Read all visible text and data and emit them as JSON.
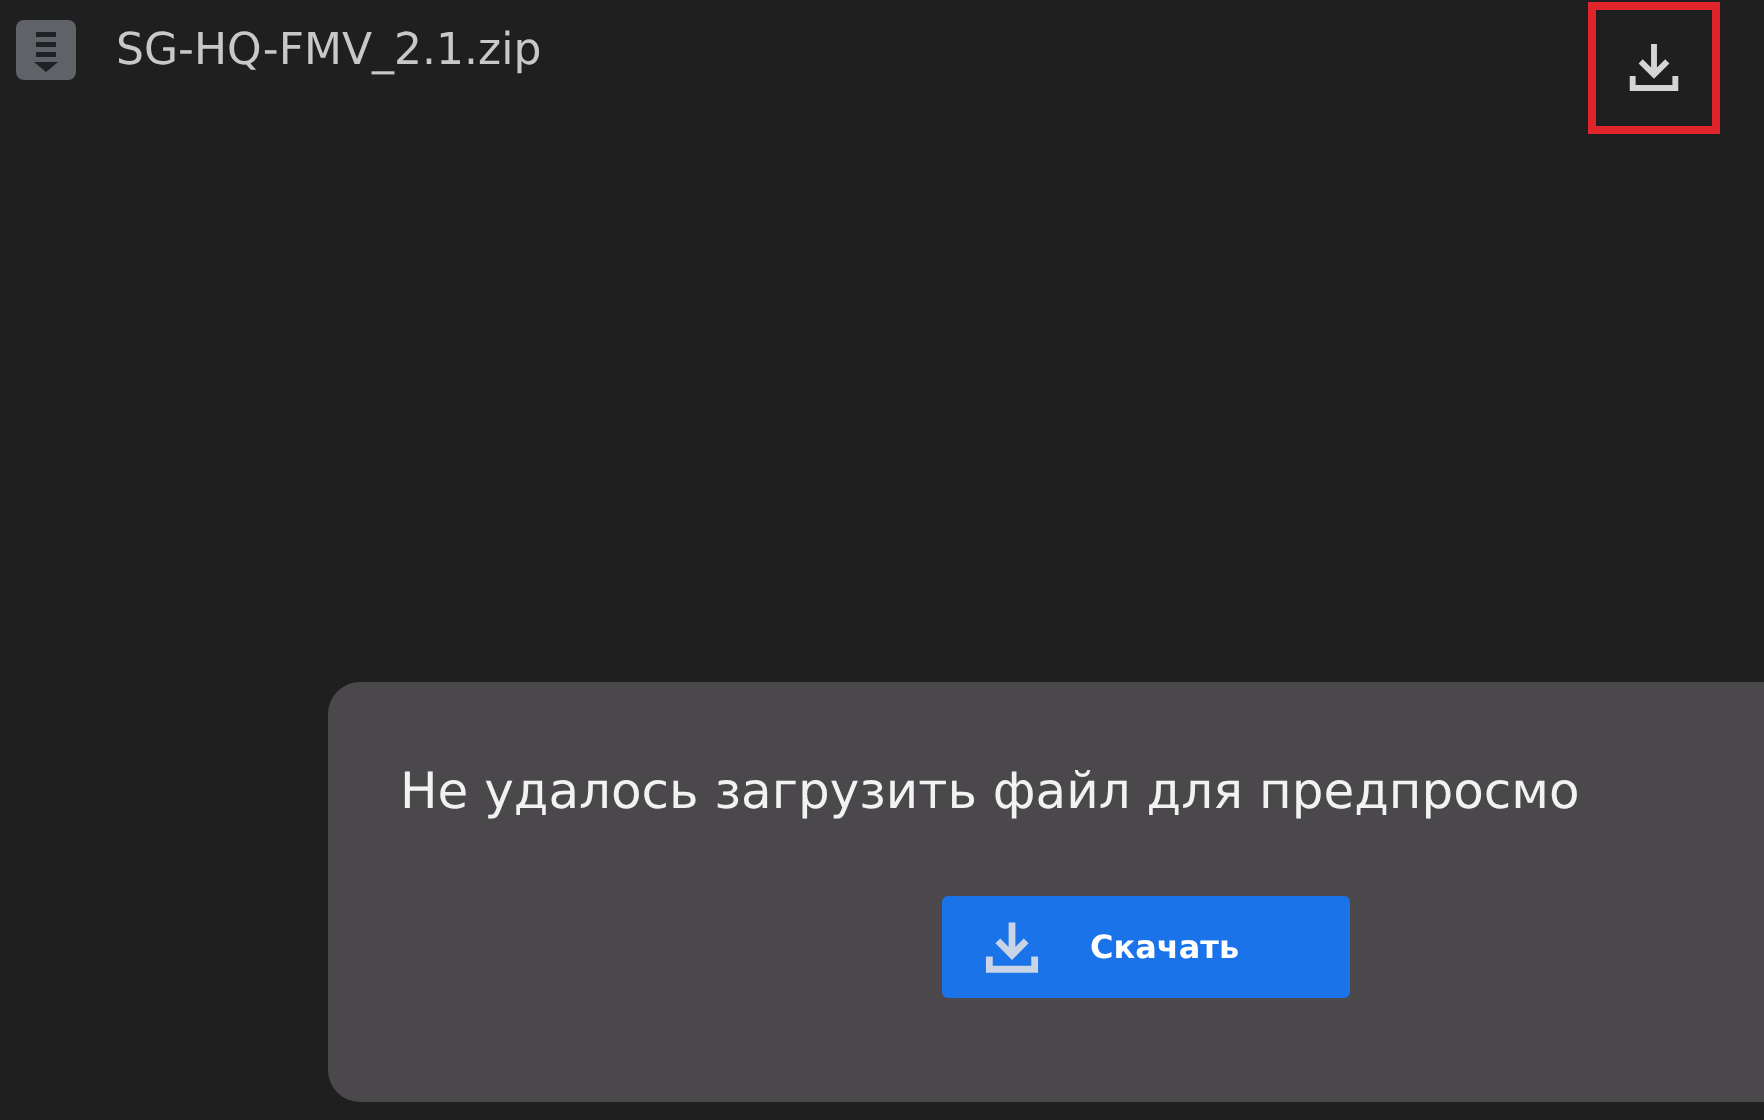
{
  "header": {
    "file_name": "SG-HQ-FMV_2.1.zip",
    "download_highlighted": true
  },
  "preview_error": {
    "message": "Не удалось загрузить файл для предпросмо",
    "button": "Скачать"
  }
}
